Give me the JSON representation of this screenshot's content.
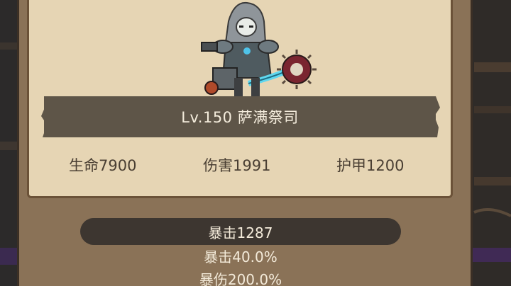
{
  "hero": {
    "title": "Lv.150 萨满祭司",
    "art_icon": "shaman-priest-character-sprite"
  },
  "stats": {
    "hp": "生命7900",
    "damage": "伤害1991",
    "armor": "护甲1200"
  },
  "bonus": {
    "crit": "暴击1287",
    "crit_rate": "暴击40.0%",
    "crit_damage": "暴伤200.0%"
  },
  "colors": {
    "parchment": "#e6d5b4",
    "frame": "#8a7257",
    "banner": "#5e5548",
    "stat_text": "#4a3f33",
    "bar": "#3d3630"
  }
}
